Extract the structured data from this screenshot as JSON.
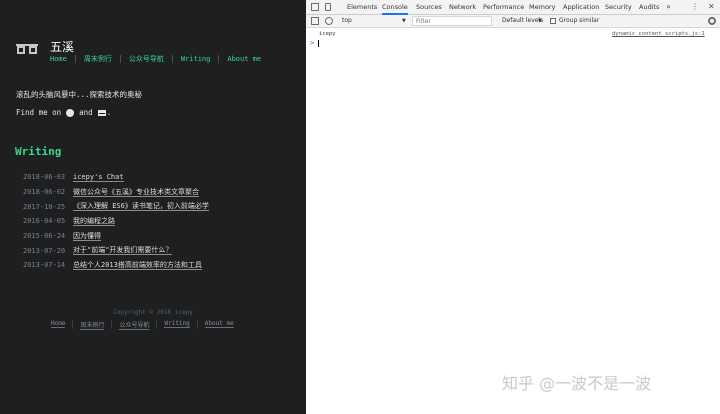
{
  "blog": {
    "site_title": "五溪",
    "nav": [
      "Home",
      "周末例行",
      "公众号导航",
      "Writing",
      "About me"
    ],
    "tagline": "滚乱的头脑风暴中...探索技术的奥秘",
    "find_me": {
      "prefix": "Find me on",
      "and": "and",
      "suffix": "."
    },
    "section_heading": "Writing",
    "posts": [
      {
        "date": "2018-06-03",
        "title": "icepy's Chat"
      },
      {
        "date": "2018-06-02",
        "title": "微信公众号《五溪》专业技术类文章聚合"
      },
      {
        "date": "2017-10-25",
        "title": "《深入理解 ES6》读书笔记，初入前端必学"
      },
      {
        "date": "2016-04-05",
        "title": "我的编程之路"
      },
      {
        "date": "2015-06-24",
        "title": "因为懂得"
      },
      {
        "date": "2013-07-20",
        "title": "对于\"前端\"开发我们需要什么？"
      },
      {
        "date": "2013-07-14",
        "title": "总结个人2013搭高前端效率的方法和工具"
      }
    ],
    "copyright": "Copyright © 2018 icepy",
    "footer_nav": [
      "Home",
      "周末例行",
      "公众号导航",
      "Writing",
      "About me"
    ]
  },
  "devtools": {
    "tabs": [
      "Elements",
      "Console",
      "Sources",
      "Network",
      "Performance",
      "Memory",
      "Application",
      "Security",
      "Audits"
    ],
    "active_tab": "Console",
    "more_tabs": "»",
    "kebab": "⋮",
    "close": "✕",
    "context": "top",
    "filter_placeholder": "Filter",
    "levels": "Default levels",
    "group_similar": "Group similar",
    "console": {
      "message": "icepy",
      "source": "dynamic_content_scripts.js:1",
      "prompt": ">"
    }
  },
  "watermark": "知乎 @一波不是一波",
  "colors": {
    "blog_bg": "#1d1f21",
    "accent_green": "#3dd68c",
    "devtools_active": "#1a73e8"
  }
}
